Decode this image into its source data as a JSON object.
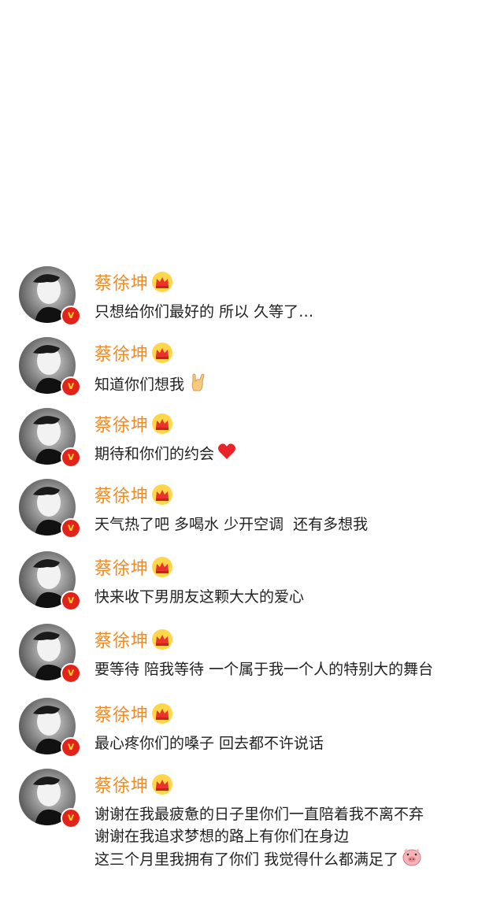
{
  "feed": {
    "posts": [
      {
        "username": "蔡徐坤",
        "text": "只想给你们最好的 所以 久等了…",
        "emoji": ""
      },
      {
        "username": "蔡徐坤",
        "text": "知道你们想我",
        "emoji": "rock-hand"
      },
      {
        "username": "蔡徐坤",
        "text": "期待和你们的约会",
        "emoji": "heart"
      },
      {
        "username": "蔡徐坤",
        "text": "天气热了吧 多喝水 少开空调  还有多想我",
        "emoji": ""
      },
      {
        "username": "蔡徐坤",
        "text": "快来收下男朋友这颗大大的爱心",
        "emoji": ""
      },
      {
        "username": "蔡徐坤",
        "text": "要等待 陪我等待 一个属于我一个人的特别大的舞台",
        "emoji": ""
      },
      {
        "username": "蔡徐坤",
        "text": "最心疼你们的嗓子 回去都不许说话",
        "emoji": ""
      },
      {
        "username": "蔡徐坤",
        "text": "谢谢在我最疲惫的日子里你们一直陪着我不离不弃\n谢谢在我追求梦想的路上有你们在身边\n这三个月里我拥有了你们 我觉得什么都满足了",
        "emoji": "pig-face"
      }
    ]
  },
  "badges": {
    "verified_letter": "v",
    "verified_color": "#e2231a",
    "username_color": "#f08a24",
    "crown_icon": "crown-icon"
  }
}
